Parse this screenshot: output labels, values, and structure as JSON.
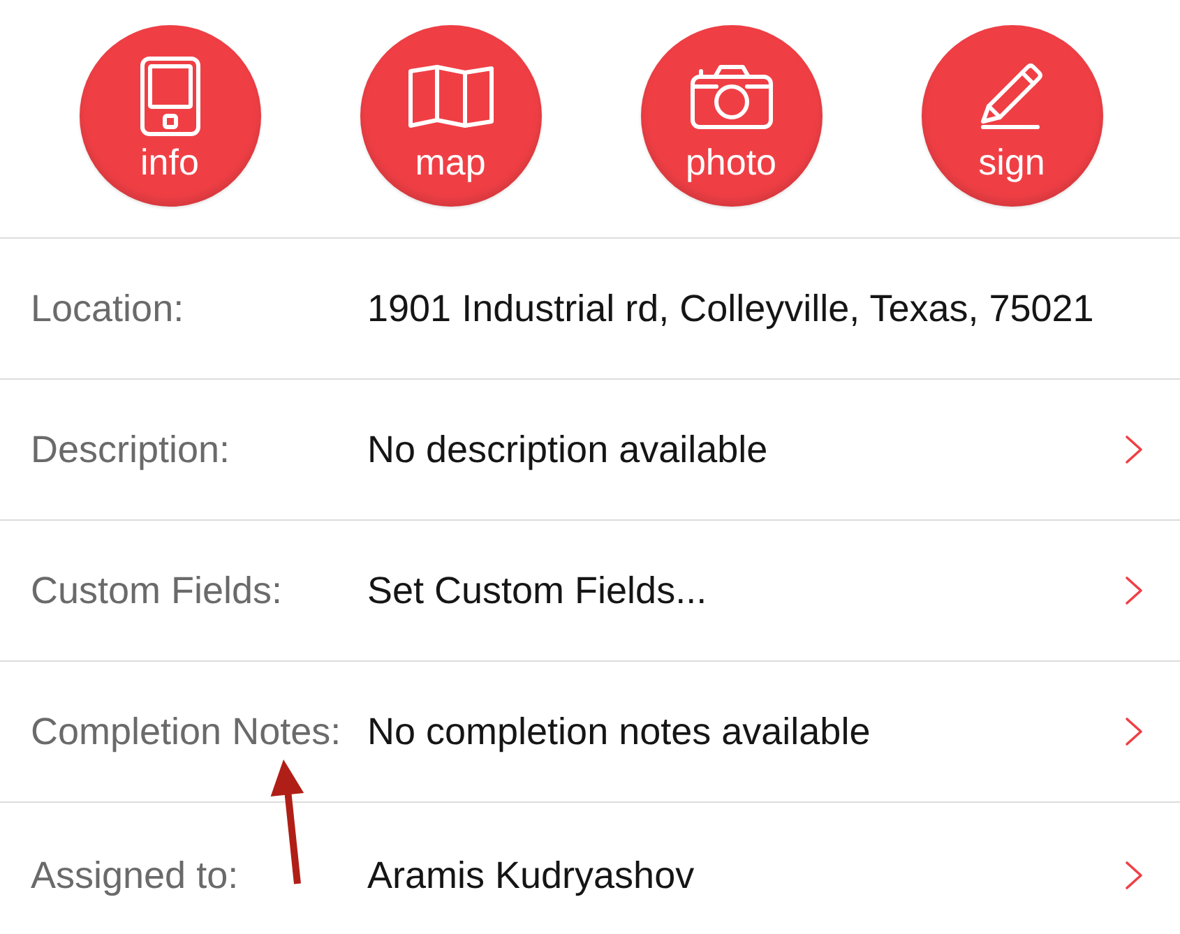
{
  "actions": [
    {
      "kind": "info",
      "label": "info"
    },
    {
      "kind": "map",
      "label": "map"
    },
    {
      "kind": "photo",
      "label": "photo"
    },
    {
      "kind": "sign",
      "label": "sign"
    }
  ],
  "fields": [
    {
      "label": "Location:",
      "value": "1901 Industrial rd, Colleyville, Texas, 75021",
      "disclosure": false
    },
    {
      "label": "Description:",
      "value": "No description available",
      "disclosure": true
    },
    {
      "label": "Custom Fields:",
      "value": "Set Custom Fields...",
      "disclosure": true
    },
    {
      "label": "Completion Notes:",
      "value": "No completion notes available",
      "disclosure": true
    },
    {
      "label": "Assigned to:",
      "value": "Aramis Kudryashov",
      "disclosure": true
    }
  ],
  "annotations": [
    {
      "kind": "arrow"
    }
  ]
}
